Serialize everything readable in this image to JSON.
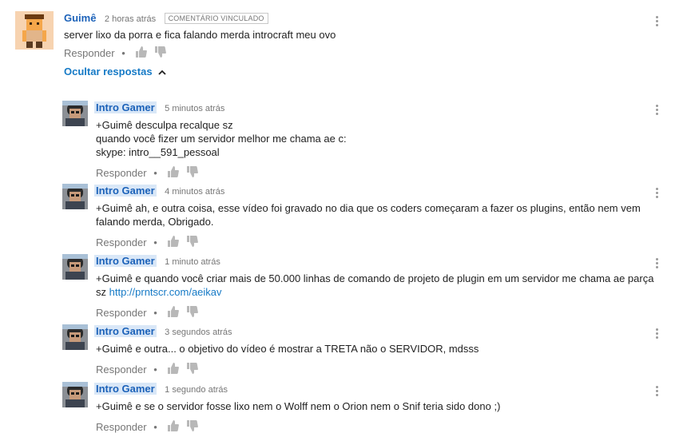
{
  "main_comment": {
    "author": "Guimê",
    "time": "2 horas atrás",
    "badge": "COMENTÁRIO VINCULADO",
    "text": "server lixo da porra e fica falando merda introcraft meu ovo",
    "reply_label": "Responder",
    "separator": "•"
  },
  "hide_replies_label": "Ocultar respostas",
  "replies": [
    {
      "author": "Intro Gamer",
      "time": "5 minutos atrás",
      "text": "+Guimê desculpa recalque sz\nquando você fizer um servidor melhor me chama ae c:\nskype: intro__591_pessoal",
      "reply_label": "Responder",
      "separator": "•"
    },
    {
      "author": "Intro Gamer",
      "time": "4 minutos atrás",
      "text": "+Guimê ah, e outra coisa, esse vídeo foi gravado no dia que os coders começaram a fazer os plugins, então nem vem\nfalando merda, Obrigado.",
      "reply_label": "Responder",
      "separator": "•"
    },
    {
      "author": "Intro Gamer",
      "time": "1 minuto atrás",
      "text": "+Guimê e quando você criar mais de 50.000 linhas de comando de projeto de plugin em um servidor me chama ae parça\nsz ",
      "link": "http://prntscr.com/aeikav",
      "reply_label": "Responder",
      "separator": "•"
    },
    {
      "author": "Intro Gamer",
      "time": "3 segundos atrás",
      "text": "+Guimê e outra... o objetivo do vídeo é mostrar a TRETA não o SERVIDOR, mdsss",
      "reply_label": "Responder",
      "separator": "•"
    },
    {
      "author": "Intro Gamer",
      "time": "1 segundo atrás",
      "text": "+Guimê e se o servidor fosse lixo nem o Wolff nem o Orion nem o Snif teria sido dono ;)",
      "reply_label": "Responder",
      "separator": "•"
    }
  ],
  "icons": {
    "like": "thumbs-up-icon",
    "dislike": "thumbs-down-icon",
    "menu": "more-vert-icon",
    "collapse": "chevron-up-icon"
  },
  "colors": {
    "author": "#1c62b9",
    "link": "#167ac6",
    "muted": "#767676",
    "author_highlight": "#d9e7f7"
  }
}
